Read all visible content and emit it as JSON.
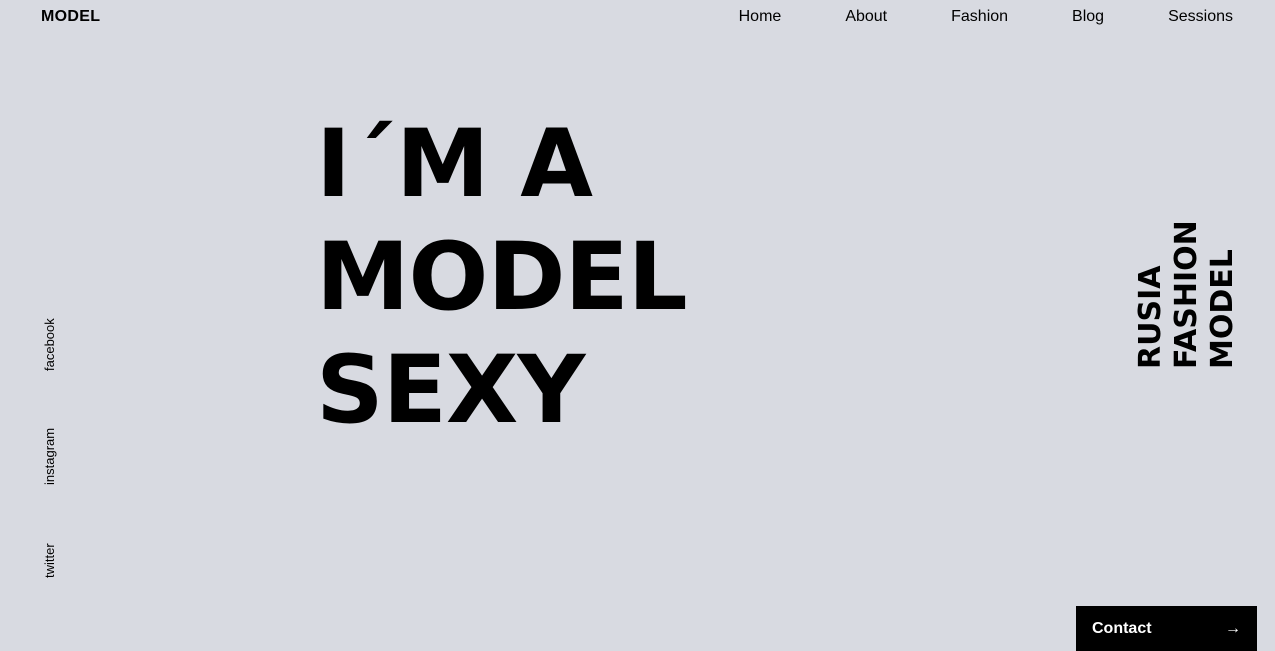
{
  "header": {
    "logo": "MODEL",
    "nav": [
      {
        "label": "Home"
      },
      {
        "label": "About"
      },
      {
        "label": "Fashion"
      },
      {
        "label": "Blog"
      },
      {
        "label": "Sessions"
      }
    ]
  },
  "hero": {
    "lines": [
      "I´M A",
      "MODEL",
      "SEXY"
    ]
  },
  "social": [
    {
      "label": "facebook"
    },
    {
      "label": "instagram"
    },
    {
      "label": "twitter"
    }
  ],
  "tagline": {
    "lines": [
      "RUSIA",
      "FASHION",
      "MODEL"
    ]
  },
  "contact": {
    "label": "Contact",
    "icon": "arrow-right-icon",
    "glyph": "→"
  },
  "colors": {
    "background": "#d8dae1",
    "text": "#000000",
    "button_bg": "#000000",
    "button_text": "#ffffff"
  }
}
